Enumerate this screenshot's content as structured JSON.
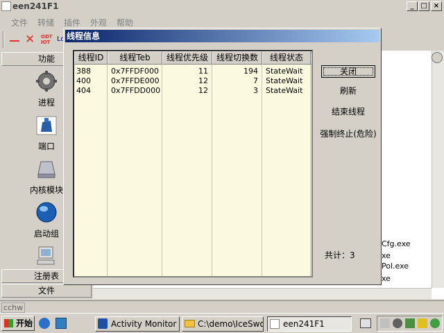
{
  "window": {
    "title": "een241F1"
  },
  "menu": [
    "文件",
    "转储",
    "插件",
    "外观",
    "帮助"
  ],
  "toolbar": {
    "icon1": "ODT\nIOT",
    "icon2": "Lo"
  },
  "left_panel": {
    "header": "功能",
    "items": [
      {
        "label": "进程",
        "icon": "gear-icon"
      },
      {
        "label": "端口",
        "icon": "network-icon"
      },
      {
        "label": "内核模块",
        "icon": "drive-icon"
      },
      {
        "label": "启动组",
        "icon": "globe-icon"
      },
      {
        "label": "",
        "icon": "computer-icon"
      }
    ],
    "registry_tab": "注册表",
    "file_tab": "文件"
  },
  "bg_list": {
    "items": [
      "Cfg.exe",
      "xe",
      "Pol.exe",
      "xe"
    ]
  },
  "status_bar": "cchw",
  "dialog": {
    "title": "线程信息",
    "columns": [
      "线程ID",
      "线程Teb",
      "线程优先级",
      "线程切换数",
      "线程状态"
    ],
    "rows": [
      [
        "388",
        "0x7FFDF000",
        "11",
        "194",
        "StateWait"
      ],
      [
        "400",
        "0x7FFDE000",
        "12",
        "7",
        "StateWait"
      ],
      [
        "404",
        "0x7FFDD000",
        "12",
        "3",
        "StateWait"
      ]
    ],
    "buttons": {
      "close": "关闭",
      "refresh": "刷新",
      "end_thread": "结束线程",
      "force_terminate": "强制终止(危险)"
    },
    "total": "共计：3"
  },
  "taskbar": {
    "start": "开始",
    "tasks": [
      "Activity Monitor -...",
      "C:\\demo\\IceSwo...",
      "een241F1"
    ]
  }
}
